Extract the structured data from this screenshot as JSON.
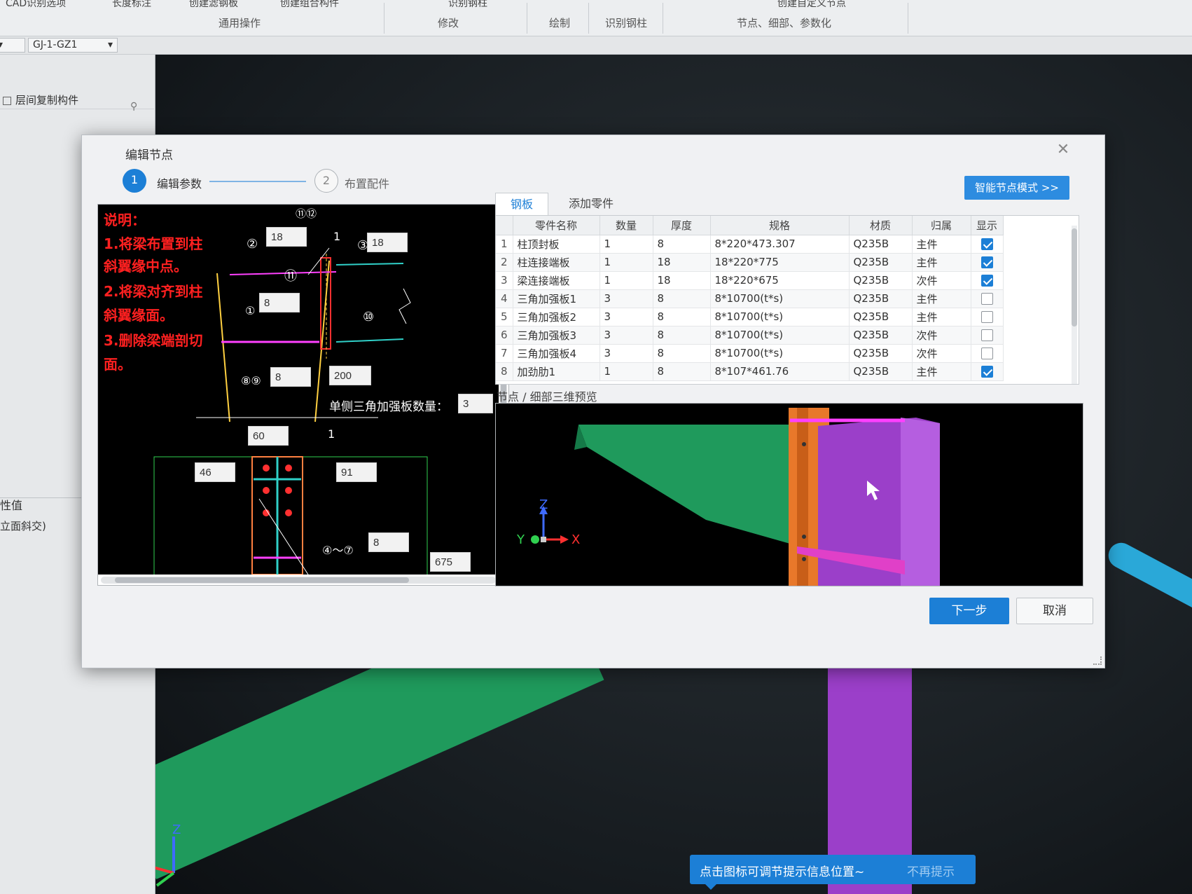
{
  "ribbon": {
    "top_items": [
      "CAD识别选项",
      "长度标注",
      "创建滤钢板",
      "创建组合构件",
      "识别钢柱",
      "创建自定义节点"
    ],
    "groups": [
      "通用操作",
      "修改",
      "绘制",
      "识别钢柱",
      "节点、细部、参数化"
    ],
    "combo_value": "GJ-1-GZ1"
  },
  "sidebar": {
    "copy_item": "层间复制构件",
    "prop_header": "性值",
    "prop_row": "立面斜交)"
  },
  "dialog": {
    "title": "编辑节点",
    "steps": [
      {
        "number": "1",
        "label": "编辑参数"
      },
      {
        "number": "2",
        "label": "布置配件"
      }
    ],
    "smart_mode_button": "智能节点模式 >>",
    "notes": [
      "说明：",
      "1.将梁布置到柱",
      "斜翼缘中点。",
      "2.将梁对齐到柱",
      "斜翼缘面。",
      "3.删除梁端剖切",
      "面。"
    ],
    "schematic": {
      "inputs": {
        "top_left": "18",
        "top_right": "18",
        "mid": "8",
        "lower": "8",
        "lower_right": "200",
        "width_60": "60",
        "left_46": "46",
        "right_91": "91",
        "bottom_8": "8",
        "bottom_675": "675",
        "tri_count": "3"
      },
      "labels": {
        "c11_12": "⑪⑫",
        "c2": "②",
        "c3": "③",
        "c11": "⑪",
        "c1": "①",
        "c10": "⑩",
        "c8_9": "⑧⑨",
        "c4_7": "④～⑦",
        "tri_count_label": "单侧三角加强板数量：",
        "section_mark_1": "1",
        "section_mark_2": "1"
      }
    },
    "tabs": [
      "钢板",
      "添加零件"
    ],
    "table": {
      "headers": [
        "",
        "零件名称",
        "数量",
        "厚度",
        "规格",
        "材质",
        "归属",
        "显示"
      ],
      "rows": [
        {
          "idx": "1",
          "name": "柱顶封板",
          "qty": "1",
          "thick": "8",
          "spec": "8*220*473.307",
          "mat": "Q235B",
          "belong": "主件",
          "show": true
        },
        {
          "idx": "2",
          "name": "柱连接端板",
          "qty": "1",
          "thick": "18",
          "spec": "18*220*775",
          "mat": "Q235B",
          "belong": "主件",
          "show": true
        },
        {
          "idx": "3",
          "name": "梁连接端板",
          "qty": "1",
          "thick": "18",
          "spec": "18*220*675",
          "mat": "Q235B",
          "belong": "次件",
          "show": true
        },
        {
          "idx": "4",
          "name": "三角加强板1",
          "qty": "3",
          "thick": "8",
          "spec": "8*10700(t*s)",
          "mat": "Q235B",
          "belong": "主件",
          "show": false
        },
        {
          "idx": "5",
          "name": "三角加强板2",
          "qty": "3",
          "thick": "8",
          "spec": "8*10700(t*s)",
          "mat": "Q235B",
          "belong": "主件",
          "show": false
        },
        {
          "idx": "6",
          "name": "三角加强板3",
          "qty": "3",
          "thick": "8",
          "spec": "8*10700(t*s)",
          "mat": "Q235B",
          "belong": "次件",
          "show": false
        },
        {
          "idx": "7",
          "name": "三角加强板4",
          "qty": "3",
          "thick": "8",
          "spec": "8*10700(t*s)",
          "mat": "Q235B",
          "belong": "次件",
          "show": false
        },
        {
          "idx": "8",
          "name": "加劲肋1",
          "qty": "1",
          "thick": "8",
          "spec": "8*107*461.76",
          "mat": "Q235B",
          "belong": "主件",
          "show": true
        }
      ]
    },
    "preview_label": "节点 / 细部三维预览",
    "axis_labels": {
      "x": "X",
      "y": "Y",
      "z": "Z"
    },
    "next_button": "下一步",
    "cancel_button": "取消"
  },
  "tip": {
    "text": "点击图标可调节提示信息位置~",
    "dismiss": "不再提示"
  },
  "colors": {
    "accent": "#1c7fd6",
    "note_red": "#ff2020",
    "beam_green": "#1f9a5c",
    "column_purple": "#9b3fc9",
    "plate_orange": "#e8782a"
  }
}
